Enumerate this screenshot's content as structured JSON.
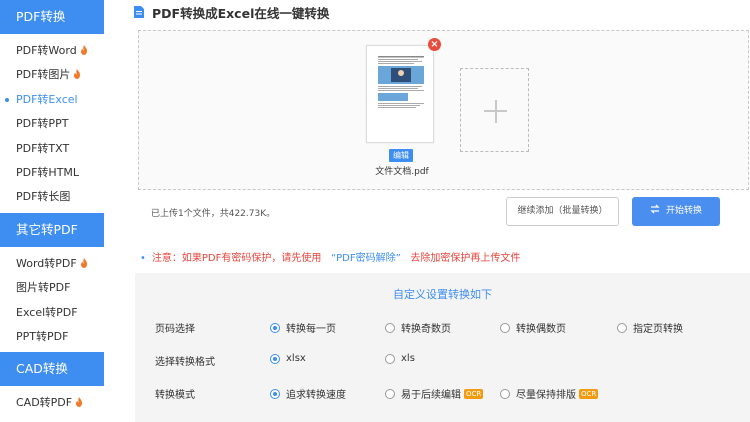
{
  "sidebar": {
    "sections": [
      {
        "title": "PDF转换"
      },
      {
        "title": "其它转PDF"
      },
      {
        "title": "CAD转换"
      }
    ],
    "pdf_items": [
      {
        "label": "PDF转Word",
        "hot": true
      },
      {
        "label": "PDF转图片",
        "hot": true
      },
      {
        "label": "PDF转Excel",
        "hot": false,
        "active": true
      },
      {
        "label": "PDF转PPT",
        "hot": false
      },
      {
        "label": "PDF转TXT",
        "hot": false
      },
      {
        "label": "PDF转HTML",
        "hot": false
      },
      {
        "label": "PDF转长图",
        "hot": false
      }
    ],
    "other_items": [
      {
        "label": "Word转PDF",
        "hot": true
      },
      {
        "label": "图片转PDF",
        "hot": false
      },
      {
        "label": "Excel转PDF",
        "hot": false
      },
      {
        "label": "PPT转PDF",
        "hot": false
      }
    ],
    "cad_items": [
      {
        "label": "CAD转PDF",
        "hot": true
      }
    ]
  },
  "main": {
    "title": "PDF转换成Excel在线一键转换",
    "file": {
      "name": "文件文档.pdf",
      "edit_label": "编辑",
      "remove_label": "×"
    },
    "status_text": "已上传1个文件，共422.73K。",
    "continue_label": "继续添加（批量转换）",
    "convert_label": "开始转换",
    "notice": {
      "prefix": "注意：如果PDF有密码保护，请先使用",
      "link": "“PDF密码解除”",
      "suffix": "去除加密保护再上传文件"
    },
    "settings": {
      "title": "自定义设置转换如下",
      "rows": [
        {
          "label": "页码选择",
          "options": [
            {
              "label": "转换每一页",
              "checked": true
            },
            {
              "label": "转换奇数页",
              "checked": false
            },
            {
              "label": "转换偶数页",
              "checked": false
            },
            {
              "label": "指定页转换",
              "checked": false
            }
          ]
        },
        {
          "label": "选择转换格式",
          "options": [
            {
              "label": "xlsx",
              "checked": true
            },
            {
              "label": "xls",
              "checked": false
            }
          ]
        },
        {
          "label": "转换模式",
          "options": [
            {
              "label": "追求转换速度",
              "checked": true
            },
            {
              "label": "易于后续编辑",
              "checked": false,
              "badge": "OCR"
            },
            {
              "label": "尽量保持排版",
              "checked": false,
              "badge": "OCR"
            }
          ]
        }
      ]
    }
  },
  "colors": {
    "accent": "#3d8ef0",
    "warning": "#e8453c",
    "hot": "#f07a2a",
    "ocr": "#f39c12"
  },
  "icons": [
    "fire-icon",
    "document-icon",
    "close-icon",
    "plus-icon",
    "swap-icon",
    "radio-icon"
  ]
}
